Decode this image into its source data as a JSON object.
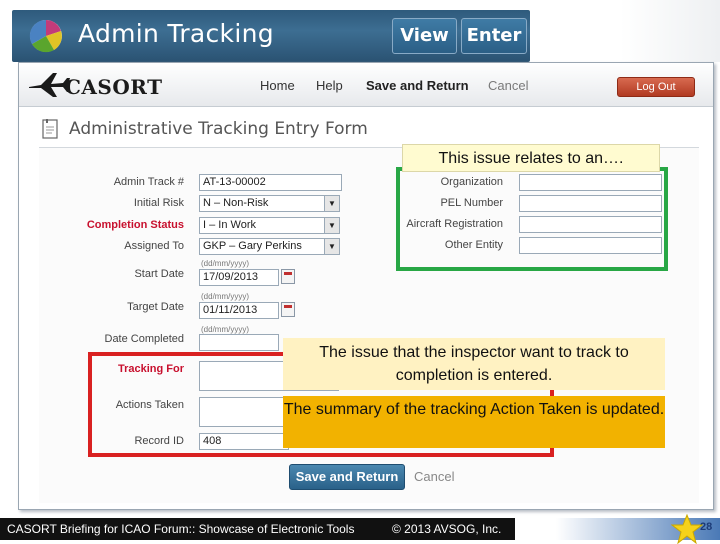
{
  "slide_header": {
    "title": "Admin Tracking",
    "view_button": "View",
    "enter_button": "Enter"
  },
  "app": {
    "brand": "CASORT",
    "nav": {
      "home": "Home",
      "help": "Help",
      "save_and_return": "Save and Return",
      "cancel": "Cancel"
    },
    "logout": "Log Out",
    "form_title": "Administrative Tracking Entry Form"
  },
  "form": {
    "labels": {
      "admin_track": "Admin Track #",
      "initial_risk": "Initial Risk",
      "completion_status": "Completion Status",
      "assigned_to": "Assigned To",
      "start_date": "Start Date",
      "target_date": "Target Date",
      "date_completed": "Date Completed",
      "tracking_for": "Tracking For",
      "actions_taken": "Actions Taken",
      "record_id": "Record ID",
      "organization": "Organization",
      "pel_number": "PEL Number",
      "aircraft_registration": "Aircraft Registration",
      "other_entity": "Other Entity"
    },
    "values": {
      "admin_track": "AT-13-00002",
      "initial_risk": "N – Non-Risk",
      "completion_status": "I – In Work",
      "assigned_to": "GKP – Gary Perkins",
      "start_date": "17/09/2013",
      "target_date": "01/11/2013",
      "record_id": "408"
    },
    "date_hint": "(dd/mm/yyyy)",
    "save_button": "Save and Return",
    "cancel_link": "Cancel"
  },
  "callouts": {
    "entity": "This issue relates to an….",
    "tracking_for": "The issue that the inspector want to track to completion is entered.",
    "actions_taken": "The summary of the tracking Action Taken is updated."
  },
  "footer": {
    "left": "CASORT Briefing for ICAO Forum:: Showcase of Electronic Tools",
    "right": "© 2013 AVSOG, Inc.",
    "page_number": "28"
  },
  "colors": {
    "banner_blue": "#2e5a7c",
    "callout_green_border": "#28a745",
    "callout_red_border": "#d92121",
    "callout_yellow": "#f2b200",
    "required_label_red": "#c8102e"
  }
}
